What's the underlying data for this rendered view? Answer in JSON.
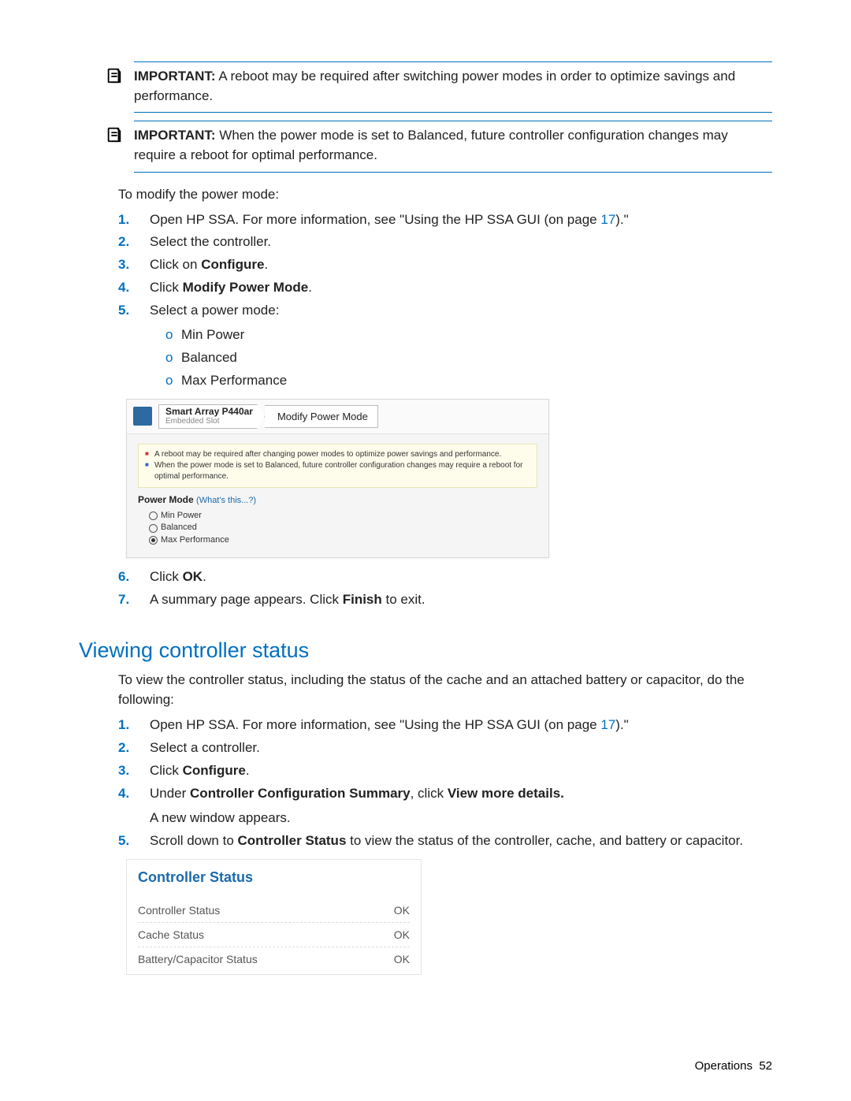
{
  "importants": [
    {
      "label": "IMPORTANT:",
      "text": "A reboot may be required after switching power modes in order to optimize savings and performance."
    },
    {
      "label": "IMPORTANT:",
      "text": "When the power mode is set to Balanced, future controller configuration changes may require a reboot for optimal performance."
    }
  ],
  "intro1": "To modify the power mode:",
  "steps1": {
    "s1a": "Open HP SSA. For more information, see \"Using the HP SSA GUI (on page ",
    "s1ref": "17",
    "s1b": ").\"",
    "s2": "Select the controller.",
    "s3a": "Click on ",
    "s3b": "Configure",
    "s3c": ".",
    "s4a": "Click ",
    "s4b": "Modify Power Mode",
    "s4c": ".",
    "s5": "Select a power mode:",
    "sub": [
      "Min Power",
      "Balanced",
      "Max Performance"
    ],
    "s6a": "Click ",
    "s6b": "OK",
    "s6c": ".",
    "s7a": "A summary page appears. Click ",
    "s7b": "Finish",
    "s7c": " to exit."
  },
  "shot1": {
    "crumb_title": "Smart Array P440ar",
    "crumb_sub": "Embedded Slot",
    "crumb2": "Modify Power Mode",
    "note1": "A reboot may be required after changing power modes to optimize power savings and performance.",
    "note2": "When the power mode is set to Balanced, future controller configuration changes may require a reboot for optimal performance.",
    "pm_label": "Power Mode",
    "pm_hint": "(What's this...?)",
    "opts": [
      "Min Power",
      "Balanced",
      "Max Performance"
    ]
  },
  "heading2": "Viewing controller status",
  "intro2": "To view the controller status, including the status of the cache and an attached battery or capacitor, do the following:",
  "steps2": {
    "s1a": "Open HP SSA. For more information, see \"Using the HP SSA GUI (on page ",
    "s1ref": "17",
    "s1b": ").\"",
    "s2": "Select a controller.",
    "s3a": "Click ",
    "s3b": "Configure",
    "s3c": ".",
    "s4a": "Under ",
    "s4b": "Controller Configuration Summary",
    "s4c": ", click ",
    "s4d": "View more details.",
    "s4e": "A new window appears.",
    "s5a": "Scroll down to ",
    "s5b": "Controller Status",
    "s5c": " to view the status of the controller, cache, and battery or capacitor."
  },
  "shot2": {
    "title": "Controller Status",
    "rows": [
      {
        "label": "Controller Status",
        "value": "OK"
      },
      {
        "label": "Cache Status",
        "value": "OK"
      },
      {
        "label": "Battery/Capacitor Status",
        "value": "OK"
      }
    ]
  },
  "footer": {
    "section": "Operations",
    "page": "52"
  }
}
